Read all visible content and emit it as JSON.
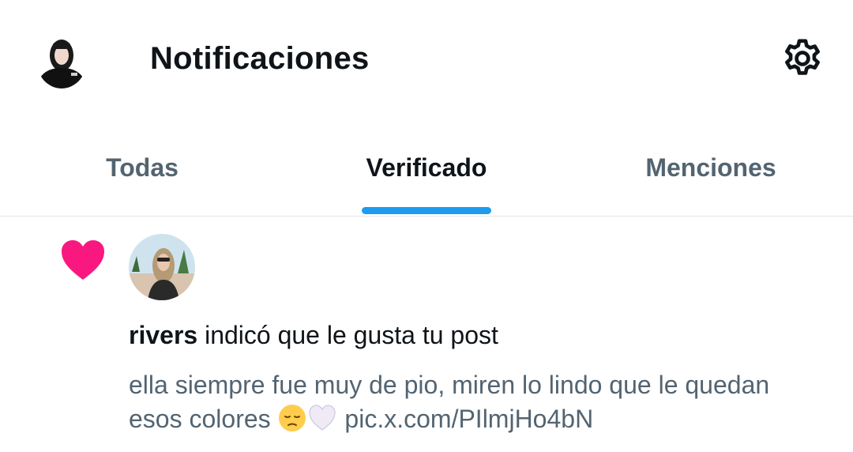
{
  "header": {
    "title": "Notificaciones",
    "avatar_icon": "user-avatar",
    "settings_icon": "gear-icon"
  },
  "tabs": [
    {
      "label": "Todas",
      "active": false
    },
    {
      "label": "Verificado",
      "active": true
    },
    {
      "label": "Menciones",
      "active": false
    }
  ],
  "notification": {
    "icon": "heart-icon",
    "icon_color": "#f91880",
    "username": "rivers",
    "action_text": " indicó que le gusta tu post",
    "post_text": "ella siempre fue muy de pio, miren lo lindo que le quedan esos colores ",
    "emojis": [
      "pensive-face-emoji",
      "white-heart-emoji"
    ],
    "link": "pic.x.com/PIlmjHo4bN"
  },
  "colors": {
    "accent": "#1d9bf0",
    "text_primary": "#0f1419",
    "text_secondary": "#536471",
    "like": "#f91880"
  }
}
